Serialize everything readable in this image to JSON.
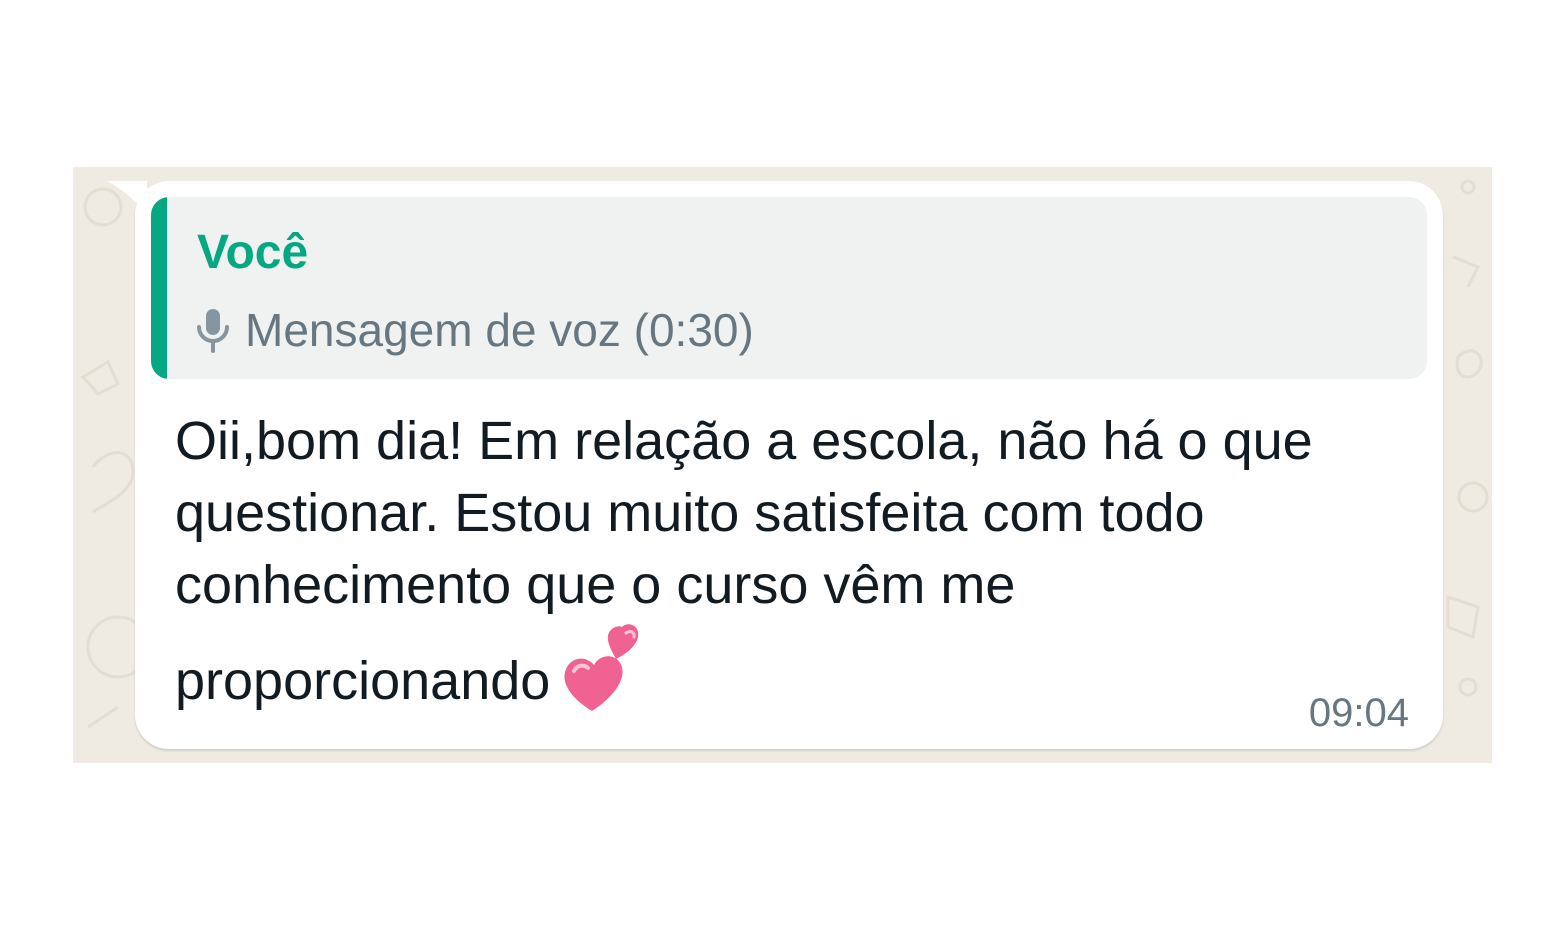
{
  "chat": {
    "background_color": "#efeae2",
    "message": {
      "quote": {
        "author": "Você",
        "icon": "mic-icon",
        "text": "Mensagem de voz (0:30)",
        "accent_color": "#06a884"
      },
      "text": "Oii,bom dia! Em relação a escola, não há o que questionar. Estou muito satisfeita com todo conhecimento que o curso vêm me proporcionando",
      "emoji": "two-hearts-icon",
      "time": "09:04"
    }
  }
}
